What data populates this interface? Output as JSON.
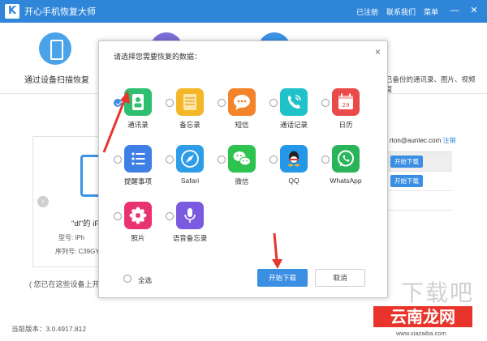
{
  "window": {
    "logo_letter": "K",
    "title": "开心手机恢复大师",
    "links": [
      "已注册",
      "联系我们",
      "菜单"
    ],
    "controls": [
      "—",
      "✕"
    ]
  },
  "background": {
    "mode_label": "通过设备扫描恢复",
    "right_text": "已备份的通讯录、图片、视频",
    "right_text2": "复",
    "account_email": "rton@auntec.com",
    "account_link": "注销",
    "download_label": "开始下载",
    "device_name": "\"dl\"的 iP",
    "device_model": "型号: iPh",
    "device_serial": "序列号: C39GY",
    "hint": "( 您已在这些设备上开",
    "version": "当前版本：3.0.4917.812"
  },
  "dialog": {
    "title": "请选择您需要恢复的数据：",
    "items": [
      {
        "label": "通讯录",
        "icon": "contacts-icon",
        "checked": true
      },
      {
        "label": "备忘录",
        "icon": "notes-icon",
        "checked": false
      },
      {
        "label": "短信",
        "icon": "sms-icon",
        "checked": false
      },
      {
        "label": "通话记录",
        "icon": "call-log-icon",
        "checked": false
      },
      {
        "label": "日历",
        "icon": "calendar-icon",
        "checked": false
      },
      {
        "label": "提醒事项",
        "icon": "reminders-icon",
        "checked": false
      },
      {
        "label": "Safari",
        "icon": "safari-icon",
        "checked": false
      },
      {
        "label": "微信",
        "icon": "wechat-icon",
        "checked": false
      },
      {
        "label": "QQ",
        "icon": "qq-icon",
        "checked": false
      },
      {
        "label": "WhatsApp",
        "icon": "whatsapp-icon",
        "checked": false
      },
      {
        "label": "照片",
        "icon": "photos-icon",
        "checked": false
      },
      {
        "label": "语音备忘录",
        "icon": "voice-memo-icon",
        "checked": false
      }
    ],
    "calendar_day": "29",
    "select_all": "全选",
    "download_button": "开始下载",
    "cancel_button": "取消",
    "close": "×"
  },
  "watermark": {
    "big": "下载吧",
    "red": "云南龙网",
    "url": "www.xiazaiba.com"
  },
  "colors": {
    "accent": "#3b8fe3",
    "titlebar": "#2f86d9",
    "arrow": "#e8342b"
  }
}
